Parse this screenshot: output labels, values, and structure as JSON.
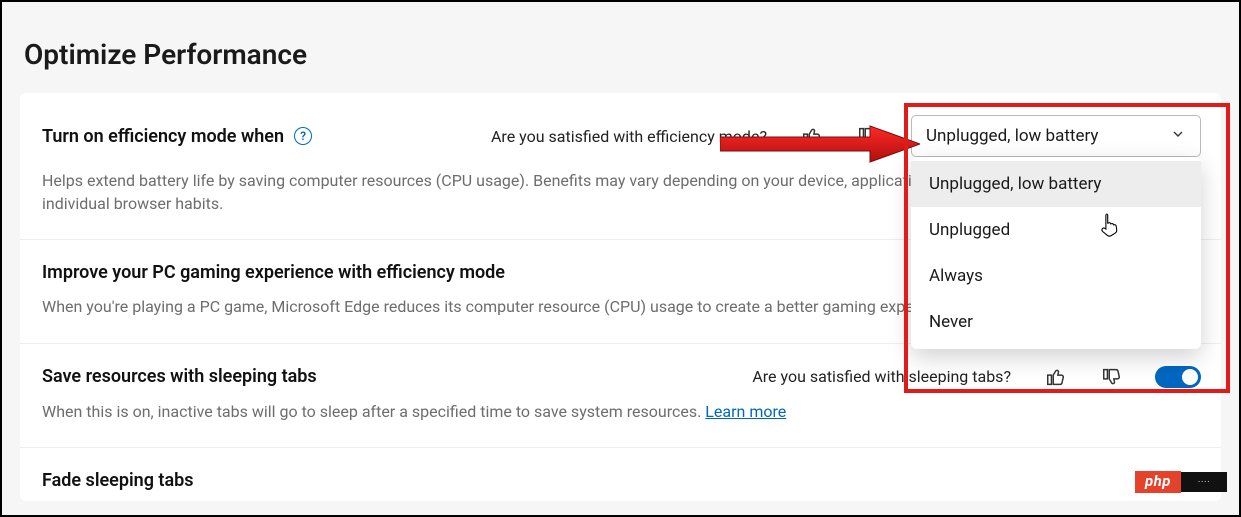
{
  "page": {
    "title": "Optimize Performance"
  },
  "efficiency": {
    "title": "Turn on efficiency mode when",
    "description": "Helps extend battery life by saving computer resources (CPU usage). Benefits may vary depending on your device, applications, and individual browser habits.",
    "feedback_q": "Are you satisfied with efficiency mode?",
    "selected": "Unplugged, low battery",
    "options": [
      "Unplugged, low battery",
      "Unplugged",
      "Always",
      "Never"
    ]
  },
  "gaming": {
    "title": "Improve your PC gaming experience with efficiency mode",
    "description": "When you're playing a PC game, Microsoft Edge reduces its computer resource (CPU) usage to create a better gaming experience."
  },
  "sleeping": {
    "title": "Save resources with sleeping tabs",
    "feedback_q": "Are you satisfied with sleeping tabs?",
    "desc_pre": "When this is on, inactive tabs will go to sleep after a specified time to save system resources. ",
    "learn_more": "Learn more",
    "toggle_on": true
  },
  "fade": {
    "title": "Fade sleeping tabs"
  },
  "annotation": {
    "brand": "php"
  },
  "colors": {
    "accent": "#0067c0",
    "highlight": "#e11b1a"
  }
}
